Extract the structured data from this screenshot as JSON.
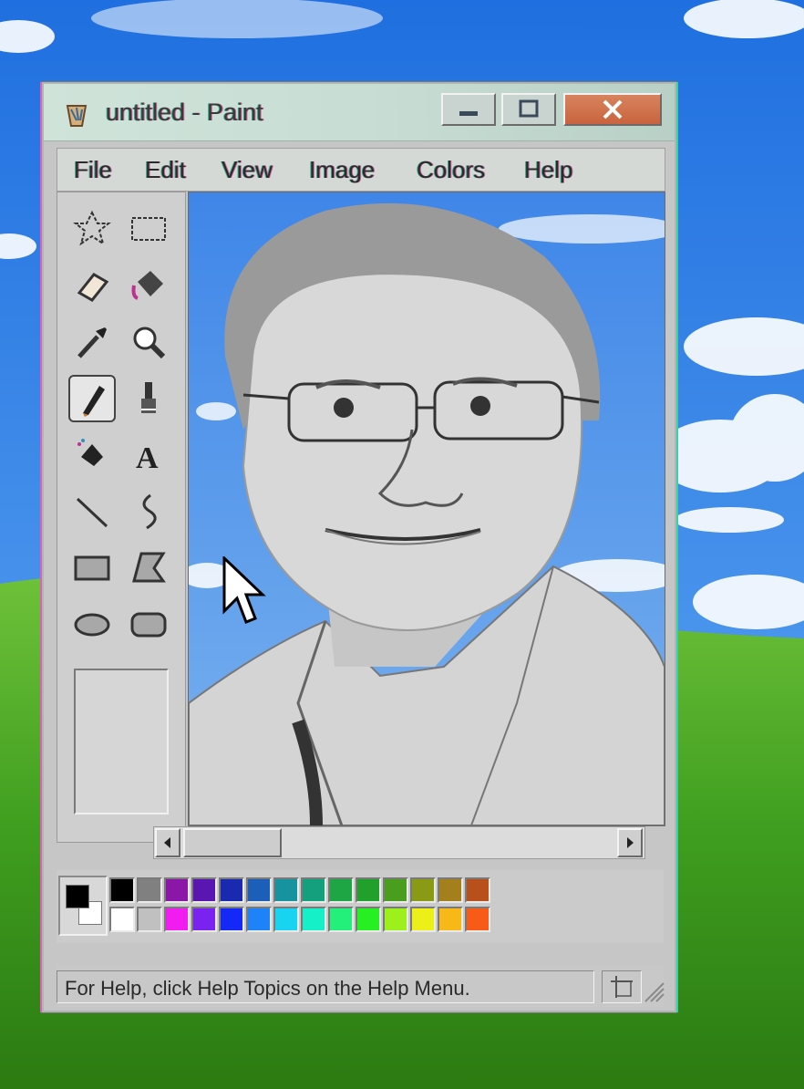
{
  "window": {
    "title": "untitled - Paint"
  },
  "menu": {
    "items": [
      {
        "label": "File"
      },
      {
        "label": "Edit"
      },
      {
        "label": "View"
      },
      {
        "label": "Image"
      },
      {
        "label": "Colors"
      },
      {
        "label": "Help"
      }
    ]
  },
  "tools": [
    {
      "icon": "free-form-select-icon"
    },
    {
      "icon": "rect-select-icon"
    },
    {
      "icon": "eraser-icon"
    },
    {
      "icon": "fill-bucket-icon"
    },
    {
      "icon": "color-picker-icon"
    },
    {
      "icon": "magnifier-icon"
    },
    {
      "icon": "pencil-icon",
      "selected": true
    },
    {
      "icon": "brush-icon"
    },
    {
      "icon": "airbrush-icon"
    },
    {
      "icon": "text-icon"
    },
    {
      "icon": "line-icon"
    },
    {
      "icon": "curve-icon"
    },
    {
      "icon": "rectangle-icon"
    },
    {
      "icon": "polygon-icon"
    },
    {
      "icon": "ellipse-icon"
    },
    {
      "icon": "rounded-rectangle-icon"
    }
  ],
  "colors": {
    "foreground": "#000000",
    "background": "#ffffff",
    "palette_top": [
      "#000000",
      "#808080",
      "#8b17a8",
      "#5a16b0",
      "#1a2ab0",
      "#1c5fb8",
      "#16939e",
      "#14a07c",
      "#1ea644",
      "#22a02c",
      "#4a9e1e",
      "#8a9a14",
      "#a4801c",
      "#b8501c"
    ],
    "palette_bottom": [
      "#ffffff",
      "#c0c0c0",
      "#f01cf0",
      "#7a22f0",
      "#1428f8",
      "#1e82f8",
      "#18d4f0",
      "#16f0c8",
      "#22f07a",
      "#26f022",
      "#9cf01c",
      "#ecf018",
      "#f8b818",
      "#f85a18"
    ]
  },
  "status": {
    "help_text": "For Help, click Help Topics on the Help Menu."
  }
}
